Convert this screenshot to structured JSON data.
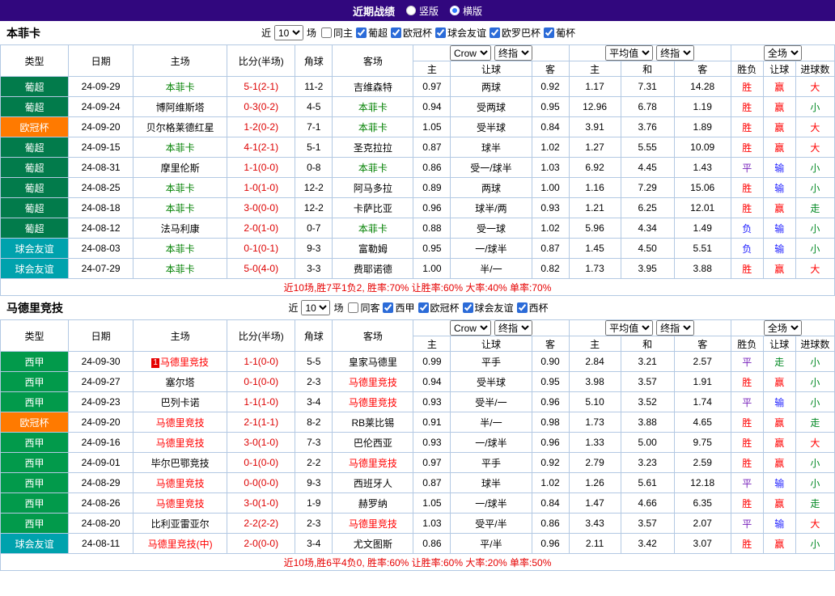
{
  "topbar": {
    "title": "近期战绩",
    "radios": [
      {
        "label": "竖版",
        "selected": false
      },
      {
        "label": "横版",
        "selected": true
      }
    ]
  },
  "colors": {
    "topbar_bg": "#31077e",
    "border": "#b3c9e3",
    "summary_text": "#e60000",
    "score": "#dd0000",
    "rank_badge_bg": "#e60000",
    "league": {
      "葡超": "#027b4b",
      "欧冠杯": "#ff7a00",
      "球会友谊": "#00a2ad",
      "西甲": "#029a4b"
    },
    "result": {
      "胜": "#ff0000",
      "平": "#7722bb",
      "负": "#2222ff"
    },
    "handicap": {
      "赢": "#ff0000",
      "输": "#2222ff",
      "走": "#008822"
    },
    "goals": {
      "大": "#ff0000",
      "小": "#008822",
      "走": "#008822"
    }
  },
  "table_header": {
    "type": "类型",
    "date": "日期",
    "home": "主场",
    "score": "比分(半场)",
    "corners": "角球",
    "away": "客场",
    "odds_selects": [
      "Crow",
      "终指"
    ],
    "avg_selects": [
      "平均值",
      "终指"
    ],
    "full_select": "全场",
    "odds_cols": [
      "主",
      "让球",
      "客"
    ],
    "avg_cols": [
      "主",
      "和",
      "客"
    ],
    "result_cols": [
      "胜负",
      "让球",
      "进球数"
    ]
  },
  "sections": [
    {
      "team": "本菲卡",
      "team_color": "#008000",
      "filter": {
        "near": "近",
        "count": "10",
        "games": "场",
        "same_venue": {
          "label": "同主",
          "checked": false
        },
        "leagues": [
          {
            "label": "葡超",
            "checked": true
          },
          {
            "label": "欧冠杯",
            "checked": true
          },
          {
            "label": "球会友谊",
            "checked": true
          },
          {
            "label": "欧罗巴杯",
            "checked": true
          },
          {
            "label": "葡杯",
            "checked": true
          }
        ]
      },
      "rows": [
        {
          "league": "葡超",
          "date": "24-09-29",
          "home": "本菲卡",
          "home_focus": true,
          "score": "5-1(2-1)",
          "corners": "11-2",
          "away": "吉维森特",
          "away_focus": false,
          "odds": [
            "0.97",
            "两球",
            "0.92"
          ],
          "avg": [
            "1.17",
            "7.31",
            "14.28"
          ],
          "results": [
            "胜",
            "赢",
            "大"
          ]
        },
        {
          "league": "葡超",
          "date": "24-09-24",
          "home": "博阿维斯塔",
          "home_focus": false,
          "score": "0-3(0-2)",
          "corners": "4-5",
          "away": "本菲卡",
          "away_focus": true,
          "odds": [
            "0.94",
            "受两球",
            "0.95"
          ],
          "avg": [
            "12.96",
            "6.78",
            "1.19"
          ],
          "results": [
            "胜",
            "赢",
            "小"
          ]
        },
        {
          "league": "欧冠杯",
          "date": "24-09-20",
          "home": "贝尔格莱德红星",
          "home_focus": false,
          "score": "1-2(0-2)",
          "corners": "7-1",
          "away": "本菲卡",
          "away_focus": true,
          "odds": [
            "1.05",
            "受半球",
            "0.84"
          ],
          "avg": [
            "3.91",
            "3.76",
            "1.89"
          ],
          "results": [
            "胜",
            "赢",
            "大"
          ]
        },
        {
          "league": "葡超",
          "date": "24-09-15",
          "home": "本菲卡",
          "home_focus": true,
          "score": "4-1(2-1)",
          "corners": "5-1",
          "away": "圣克拉拉",
          "away_focus": false,
          "odds": [
            "0.87",
            "球半",
            "1.02"
          ],
          "avg": [
            "1.27",
            "5.55",
            "10.09"
          ],
          "results": [
            "胜",
            "赢",
            "大"
          ]
        },
        {
          "league": "葡超",
          "date": "24-08-31",
          "home": "摩里伦斯",
          "home_focus": false,
          "score": "1-1(0-0)",
          "corners": "0-8",
          "away": "本菲卡",
          "away_focus": true,
          "odds": [
            "0.86",
            "受一/球半",
            "1.03"
          ],
          "avg": [
            "6.92",
            "4.45",
            "1.43"
          ],
          "results": [
            "平",
            "输",
            "小"
          ]
        },
        {
          "league": "葡超",
          "date": "24-08-25",
          "home": "本菲卡",
          "home_focus": true,
          "score": "1-0(1-0)",
          "corners": "12-2",
          "away": "阿马多拉",
          "away_focus": false,
          "odds": [
            "0.89",
            "两球",
            "1.00"
          ],
          "avg": [
            "1.16",
            "7.29",
            "15.06"
          ],
          "results": [
            "胜",
            "输",
            "小"
          ]
        },
        {
          "league": "葡超",
          "date": "24-08-18",
          "home": "本菲卡",
          "home_focus": true,
          "score": "3-0(0-0)",
          "corners": "12-2",
          "away": "卡萨比亚",
          "away_focus": false,
          "odds": [
            "0.96",
            "球半/两",
            "0.93"
          ],
          "avg": [
            "1.21",
            "6.25",
            "12.01"
          ],
          "results": [
            "胜",
            "赢",
            "走"
          ]
        },
        {
          "league": "葡超",
          "date": "24-08-12",
          "home": "法马利康",
          "home_focus": false,
          "score": "2-0(1-0)",
          "corners": "0-7",
          "away": "本菲卡",
          "away_focus": true,
          "odds": [
            "0.88",
            "受一球",
            "1.02"
          ],
          "avg": [
            "5.96",
            "4.34",
            "1.49"
          ],
          "results": [
            "负",
            "输",
            "小"
          ]
        },
        {
          "league": "球会友谊",
          "date": "24-08-03",
          "home": "本菲卡",
          "home_focus": true,
          "score": "0-1(0-1)",
          "corners": "9-3",
          "away": "富勒姆",
          "away_focus": false,
          "odds": [
            "0.95",
            "一/球半",
            "0.87"
          ],
          "avg": [
            "1.45",
            "4.50",
            "5.51"
          ],
          "results": [
            "负",
            "输",
            "小"
          ]
        },
        {
          "league": "球会友谊",
          "date": "24-07-29",
          "home": "本菲卡",
          "home_focus": true,
          "score": "5-0(4-0)",
          "corners": "3-3",
          "away": "费耶诺德",
          "away_focus": false,
          "odds": [
            "1.00",
            "半/一",
            "0.82"
          ],
          "avg": [
            "1.73",
            "3.95",
            "3.88"
          ],
          "results": [
            "胜",
            "赢",
            "大"
          ]
        }
      ],
      "summary": "近10场,胜7平1负2, 胜率:70% 让胜率:60% 大率:40% 单率:70%"
    },
    {
      "team": "马德里竞技",
      "team_color": "#ff0000",
      "filter": {
        "near": "近",
        "count": "10",
        "games": "场",
        "same_venue": {
          "label": "同客",
          "checked": false
        },
        "leagues": [
          {
            "label": "西甲",
            "checked": true
          },
          {
            "label": "欧冠杯",
            "checked": true
          },
          {
            "label": "球会友谊",
            "checked": true
          },
          {
            "label": "西杯",
            "checked": true
          }
        ]
      },
      "rows": [
        {
          "league": "西甲",
          "date": "24-09-30",
          "home": "马德里竞技",
          "home_focus": true,
          "home_badge": "1",
          "score": "1-1(0-0)",
          "corners": "5-5",
          "away": "皇家马德里",
          "away_focus": false,
          "odds": [
            "0.99",
            "平手",
            "0.90"
          ],
          "avg": [
            "2.84",
            "3.21",
            "2.57"
          ],
          "results": [
            "平",
            "走",
            "小"
          ]
        },
        {
          "league": "西甲",
          "date": "24-09-27",
          "home": "塞尔塔",
          "home_focus": false,
          "score": "0-1(0-0)",
          "corners": "2-3",
          "away": "马德里竞技",
          "away_focus": true,
          "odds": [
            "0.94",
            "受半球",
            "0.95"
          ],
          "avg": [
            "3.98",
            "3.57",
            "1.91"
          ],
          "results": [
            "胜",
            "赢",
            "小"
          ]
        },
        {
          "league": "西甲",
          "date": "24-09-23",
          "home": "巴列卡诺",
          "home_focus": false,
          "score": "1-1(1-0)",
          "corners": "3-4",
          "away": "马德里竞技",
          "away_focus": true,
          "odds": [
            "0.93",
            "受半/一",
            "0.96"
          ],
          "avg": [
            "5.10",
            "3.52",
            "1.74"
          ],
          "results": [
            "平",
            "输",
            "小"
          ]
        },
        {
          "league": "欧冠杯",
          "date": "24-09-20",
          "home": "马德里竞技",
          "home_focus": true,
          "score": "2-1(1-1)",
          "corners": "8-2",
          "away": "RB莱比锡",
          "away_focus": false,
          "odds": [
            "0.91",
            "半/一",
            "0.98"
          ],
          "avg": [
            "1.73",
            "3.88",
            "4.65"
          ],
          "results": [
            "胜",
            "赢",
            "走"
          ]
        },
        {
          "league": "西甲",
          "date": "24-09-16",
          "home": "马德里竞技",
          "home_focus": true,
          "score": "3-0(1-0)",
          "corners": "7-3",
          "away": "巴伦西亚",
          "away_focus": false,
          "odds": [
            "0.93",
            "一/球半",
            "0.96"
          ],
          "avg": [
            "1.33",
            "5.00",
            "9.75"
          ],
          "results": [
            "胜",
            "赢",
            "大"
          ]
        },
        {
          "league": "西甲",
          "date": "24-09-01",
          "home": "毕尔巴鄂竞技",
          "home_focus": false,
          "score": "0-1(0-0)",
          "corners": "2-2",
          "away": "马德里竞技",
          "away_focus": true,
          "odds": [
            "0.97",
            "平手",
            "0.92"
          ],
          "avg": [
            "2.79",
            "3.23",
            "2.59"
          ],
          "results": [
            "胜",
            "赢",
            "小"
          ]
        },
        {
          "league": "西甲",
          "date": "24-08-29",
          "home": "马德里竞技",
          "home_focus": true,
          "score": "0-0(0-0)",
          "corners": "9-3",
          "away": "西班牙人",
          "away_focus": false,
          "odds": [
            "0.87",
            "球半",
            "1.02"
          ],
          "avg": [
            "1.26",
            "5.61",
            "12.18"
          ],
          "results": [
            "平",
            "输",
            "小"
          ]
        },
        {
          "league": "西甲",
          "date": "24-08-26",
          "home": "马德里竞技",
          "home_focus": true,
          "score": "3-0(1-0)",
          "corners": "1-9",
          "away": "赫罗纳",
          "away_focus": false,
          "odds": [
            "1.05",
            "一/球半",
            "0.84"
          ],
          "avg": [
            "1.47",
            "4.66",
            "6.35"
          ],
          "results": [
            "胜",
            "赢",
            "走"
          ]
        },
        {
          "league": "西甲",
          "date": "24-08-20",
          "home": "比利亚雷亚尔",
          "home_focus": false,
          "score": "2-2(2-2)",
          "corners": "2-3",
          "away": "马德里竞技",
          "away_focus": true,
          "odds": [
            "1.03",
            "受平/半",
            "0.86"
          ],
          "avg": [
            "3.43",
            "3.57",
            "2.07"
          ],
          "results": [
            "平",
            "输",
            "大"
          ]
        },
        {
          "league": "球会友谊",
          "date": "24-08-11",
          "home": "马德里竞技(中)",
          "home_focus": true,
          "score": "2-0(0-0)",
          "corners": "3-4",
          "away": "尤文图斯",
          "away_focus": false,
          "odds": [
            "0.86",
            "平/半",
            "0.96"
          ],
          "avg": [
            "2.11",
            "3.42",
            "3.07"
          ],
          "results": [
            "胜",
            "赢",
            "小"
          ]
        }
      ],
      "summary": "近10场,胜6平4负0, 胜率:60% 让胜率:60% 大率:20% 单率:50%"
    }
  ]
}
